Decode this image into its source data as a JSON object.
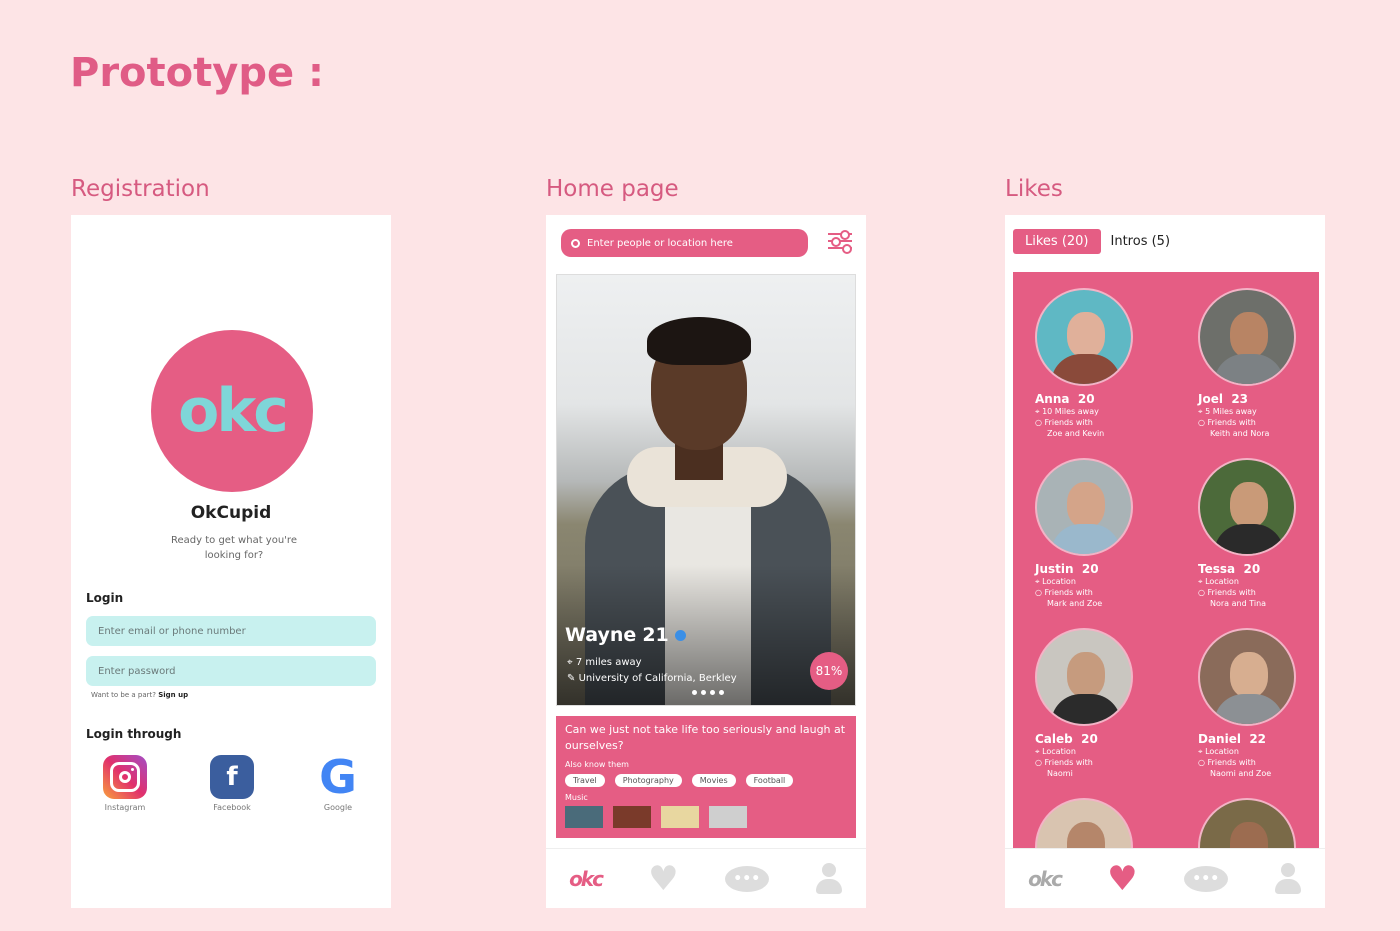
{
  "page_title": "Prototype :",
  "sections": {
    "registration": "Registration",
    "home": "Home page",
    "likes": "Likes"
  },
  "registration": {
    "logo_text": "okc",
    "brand": "OkCupid",
    "tagline": "Ready to get what you're looking for?",
    "login_label": "Login",
    "email_placeholder": "Enter email or phone number",
    "password_placeholder": "Enter password",
    "signup_prompt": "Want to be a part?",
    "signup_link": "Sign up",
    "login_through": "Login through",
    "social": [
      {
        "label": "Instagram",
        "icon": "instagram-icon"
      },
      {
        "label": "Facebook",
        "icon": "facebook-icon"
      },
      {
        "label": "Google",
        "icon": "google-icon"
      }
    ]
  },
  "home": {
    "search_placeholder": "Enter people or location here",
    "profile": {
      "name": "Wayne",
      "age": "21",
      "distance": "7 miles away",
      "school": "University of California, Berkley",
      "match": "81%"
    },
    "bio": "Can we just not take life too seriously and laugh at ourselves?",
    "also_know": "Also know them",
    "tags": [
      "Travel",
      "Photography",
      "Movies",
      "Football"
    ],
    "music_label": "Music"
  },
  "likes": {
    "tab_likes": "Likes (20)",
    "tab_intros": "Intros (5)",
    "people": [
      {
        "name": "Anna",
        "age": "20",
        "loc": "10 Miles away",
        "friends1": "Friends with",
        "friends2": "Zoe and Kevin"
      },
      {
        "name": "Joel",
        "age": "23",
        "loc": "5 Miles away",
        "friends1": "Friends with",
        "friends2": "Keith and Nora"
      },
      {
        "name": "Justin",
        "age": "20",
        "loc": "Location",
        "friends1": "Friends with",
        "friends2": "Mark and Zoe"
      },
      {
        "name": "Tessa",
        "age": "20",
        "loc": "Location",
        "friends1": "Friends with",
        "friends2": "Nora and Tina"
      },
      {
        "name": "Caleb",
        "age": "20",
        "loc": "Location",
        "friends1": "Friends with",
        "friends2": "Naomi"
      },
      {
        "name": "Daniel",
        "age": "22",
        "loc": "Location",
        "friends1": "Friends with",
        "friends2": "Naomi and Zoe"
      }
    ]
  },
  "tabbar": {
    "logo": "okc",
    "chat_dots": "•••"
  },
  "colors": {
    "accent": "#e55d84",
    "mint": "#c8f1ef",
    "background": "#fde4e6"
  }
}
